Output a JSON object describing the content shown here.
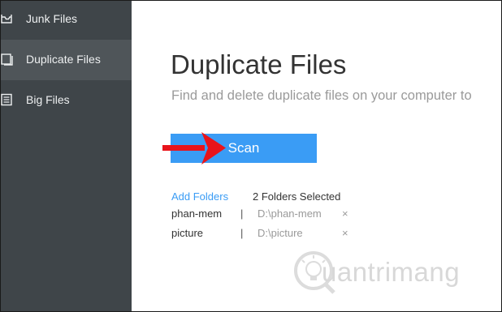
{
  "sidebar": {
    "items": [
      {
        "label": "Junk Files",
        "icon": "junk-files-icon",
        "active": false
      },
      {
        "label": "Duplicate Files",
        "icon": "duplicate-files-icon",
        "active": true
      },
      {
        "label": "Big Files",
        "icon": "big-files-icon",
        "active": false
      }
    ]
  },
  "main": {
    "title": "Duplicate Files",
    "subtitle": "Find and delete duplicate files on your computer to",
    "scan_label": "Scan",
    "add_folders_label": "Add Folders",
    "selected_count": "2 Folders Selected",
    "separator": "|",
    "close_glyph": "×",
    "folders": [
      {
        "name": "phan-mem",
        "path": "D:\\phan-mem"
      },
      {
        "name": "picture",
        "path": "D:\\picture"
      }
    ]
  },
  "watermark": {
    "text": "uantrimang"
  },
  "colors": {
    "sidebar_bg": "#3f4549",
    "sidebar_active": "#4f5559",
    "accent": "#3a9cf5",
    "arrow": "#e8141b"
  }
}
